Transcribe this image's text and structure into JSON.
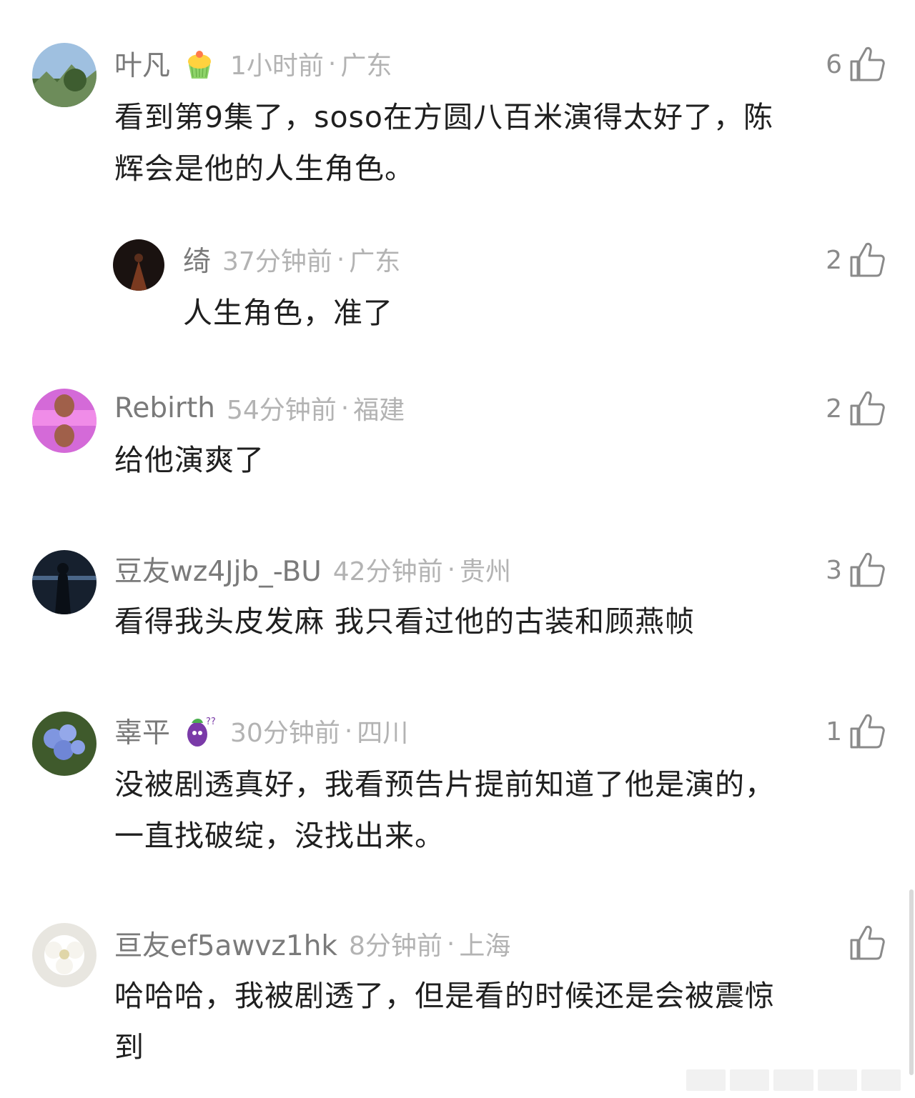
{
  "comments": [
    {
      "username": "叶凡",
      "time": "1小时前",
      "sep": "·",
      "location": "广东",
      "likes": "6",
      "badge": "cupcake-icon",
      "lines": [
        "看到第9集了，soso在方圆八百米演得太好了，陈",
        "辉会是他的人生角色。"
      ]
    },
    {
      "username": "绮",
      "time": "37分钟前",
      "sep": "·",
      "location": "广东",
      "likes": "2",
      "lines": [
        "人生角色，准了"
      ]
    },
    {
      "username": "Rebirth",
      "time": "54分钟前",
      "sep": "·",
      "location": "福建",
      "likes": "2",
      "lines": [
        "给他演爽了"
      ]
    },
    {
      "username": "豆友wz4Jjb_-BU",
      "time": "42分钟前",
      "sep": "·",
      "location": "贵州",
      "likes": "3",
      "lines": [
        "看得我头皮发麻 我只看过他的古装和顾燕帧"
      ]
    },
    {
      "username": "辜平",
      "time": "30分钟前",
      "sep": "·",
      "location": "四川",
      "likes": "1",
      "badge": "eggplant-icon",
      "lines": [
        "没被剧透真好，我看预告片提前知道了他是演的，",
        "一直找破绽，没找出来。"
      ]
    },
    {
      "username": "亘友ef5awvz1hk",
      "time": "8分钟前",
      "sep": "·",
      "location": "上海",
      "likes": "",
      "lines": [
        "哈哈哈，我被剧透了，但是看的时候还是会被震惊",
        "到"
      ]
    }
  ],
  "colors": {
    "name": "#7a7a7a",
    "meta": "#b3b3b3",
    "text": "#1f1f1f",
    "icon": "#8a8a8a"
  }
}
